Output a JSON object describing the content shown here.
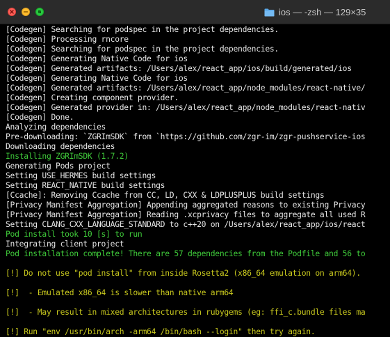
{
  "window": {
    "title": "ios — -zsh — 129×35"
  },
  "colors": {
    "background": "#000000",
    "text": "#e6e6e6",
    "green": "#3fca3a",
    "yellow": "#c9c91e"
  },
  "icons": {
    "close": "close-icon",
    "minimize": "minimize-icon",
    "maximize": "maximize-icon",
    "folder": "folder-icon"
  },
  "lines": [
    {
      "text": "[Codegen] Searching for podspec in the project dependencies.",
      "color": "default"
    },
    {
      "text": "[Codegen] Processing rncore",
      "color": "default"
    },
    {
      "text": "[Codegen] Searching for podspec in the project dependencies.",
      "color": "default"
    },
    {
      "text": "[Codegen] Generating Native Code for ios",
      "color": "default"
    },
    {
      "text": "[Codegen] Generated artifacts: /Users/alex/react_app/ios/build/generated/ios",
      "color": "default"
    },
    {
      "text": "[Codegen] Generating Native Code for ios",
      "color": "default"
    },
    {
      "text": "[Codegen] Generated artifacts: /Users/alex/react_app/node_modules/react-native/",
      "color": "default"
    },
    {
      "text": "[Codegen] Creating component provider.",
      "color": "default"
    },
    {
      "text": "[Codegen] Generated provider in: /Users/alex/react_app/node_modules/react-nativ",
      "color": "default"
    },
    {
      "text": "[Codegen] Done.",
      "color": "default"
    },
    {
      "text": "Analyzing dependencies",
      "color": "default"
    },
    {
      "text": "Pre-downloading: `ZGRImSDK` from `https://github.com/zgr-im/zgr-pushservice-ios",
      "color": "default"
    },
    {
      "text": "Downloading dependencies",
      "color": "default"
    },
    {
      "text": "Installing ZGRImSDK (1.7.2)",
      "color": "green"
    },
    {
      "text": "Generating Pods project",
      "color": "default"
    },
    {
      "text": "Setting USE_HERMES build settings",
      "color": "default"
    },
    {
      "text": "Setting REACT_NATIVE build settings",
      "color": "default"
    },
    {
      "text": "[Ccache]: Removing Ccache from CC, LD, CXX & LDPLUSPLUS build settings",
      "color": "default"
    },
    {
      "text": "[Privacy Manifest Aggregation] Appending aggregated reasons to existing Privacy",
      "color": "default"
    },
    {
      "text": "[Privacy Manifest Aggregation] Reading .xcprivacy files to aggregate all used R",
      "color": "default"
    },
    {
      "text": "Setting CLANG_CXX_LANGUAGE_STANDARD to c++20 on /Users/alex/react_app/ios/react",
      "color": "default"
    },
    {
      "text": "Pod install took 10 [s] to run",
      "color": "green"
    },
    {
      "text": "Integrating client project",
      "color": "default"
    },
    {
      "text": "Pod installation complete! There are 57 dependencies from the Podfile and 56 to",
      "color": "green"
    },
    {
      "text": "",
      "color": "default"
    },
    {
      "text": "[!] Do not use \"pod install\" from inside Rosetta2 (x86_64 emulation on arm64).",
      "color": "yellow"
    },
    {
      "text": "",
      "color": "default"
    },
    {
      "text": "[!]  - Emulated x86_64 is slower than native arm64",
      "color": "yellow"
    },
    {
      "text": "",
      "color": "default"
    },
    {
      "text": "[!]  - May result in mixed architectures in rubygems (eg: ffi_c.bundle files ma",
      "color": "yellow"
    },
    {
      "text": "",
      "color": "default"
    },
    {
      "text": "[!] Run \"env /usr/bin/arch -arm64 /bin/bash --login\" then try again.",
      "color": "yellow"
    }
  ]
}
